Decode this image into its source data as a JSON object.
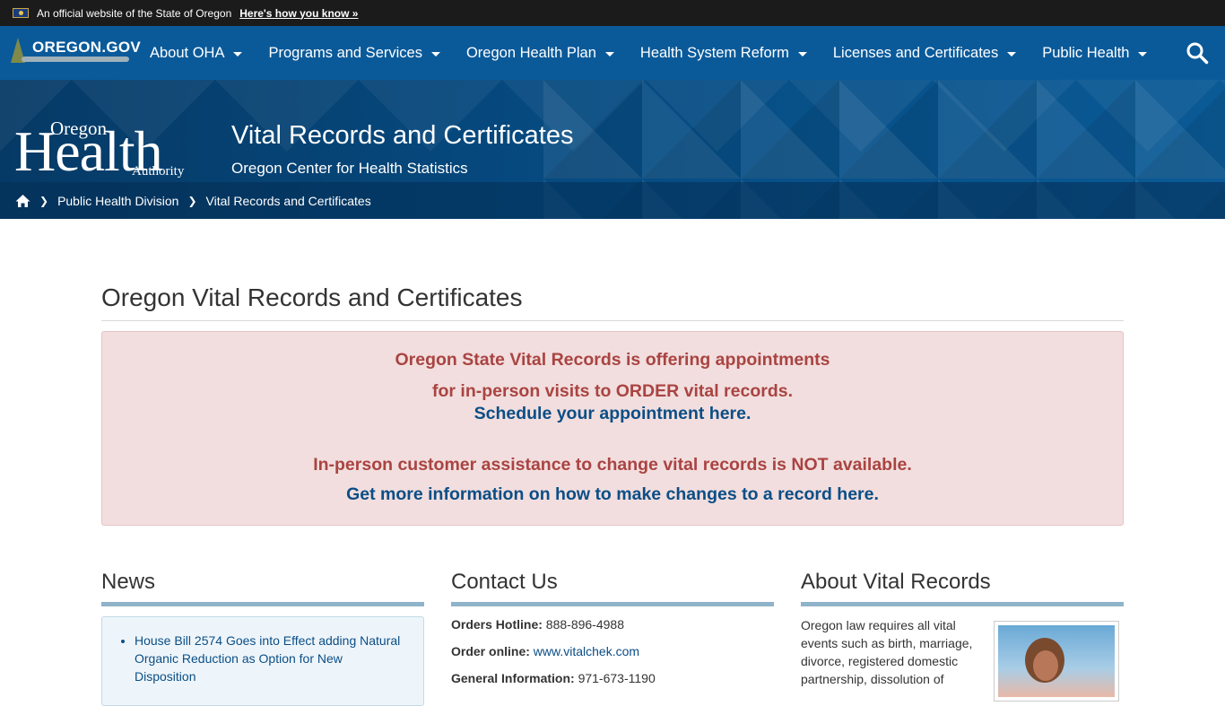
{
  "gov_banner": {
    "official_text": "An official website of the State of Oregon",
    "how_link": "Here's how you know »"
  },
  "topnav": {
    "brand": "OREGON.GOV",
    "items": [
      {
        "label": "About OHA"
      },
      {
        "label": "Programs and Services"
      },
      {
        "label": "Oregon Health Plan"
      },
      {
        "label": "Health System Reform"
      },
      {
        "label": "Licenses and Certificates"
      },
      {
        "label": "Public Health"
      }
    ],
    "search_icon": "search-icon"
  },
  "hero": {
    "logo": {
      "top": "Oregon",
      "main": "Health",
      "bottom": "Authority"
    },
    "title": "Vital Records and Certificates",
    "subtitle": "Oregon Center for Health Statistics"
  },
  "breadcrumb": {
    "items": [
      "Public Health Division",
      "Vital Records and Certificates"
    ]
  },
  "main": {
    "page_title": "Oregon Vital Records and Certificates",
    "alert": {
      "line1": "Oregon State Vital Records is offering appointments",
      "line2": "for in-person visits to ORDER vital records.",
      "line3_link": "Schedule your appointment here",
      "line3_tail": ".",
      "line4": "In-person customer assistance to change vital records is NOT available.",
      "line5_link": "Get more information on how to make changes to a record here."
    }
  },
  "news": {
    "title": "News",
    "items": [
      "House Bill 2574 Goes into Effect adding Natural Organic Reduction as Option for New Disposition"
    ]
  },
  "contact": {
    "title": "Contact Us",
    "orders_label": "Orders Hotline:",
    "orders_value": "888-896-4988",
    "online_label": "Order online:",
    "online_value": "www.vitalchek.com",
    "info_label": "General Information:",
    "info_value": "971-673-1190"
  },
  "about": {
    "title": "About Vital Records",
    "text": "Oregon law requires all vital events such as birth, marriage, divorce, registered domestic partnership, dissolution of"
  },
  "colors": {
    "nav_bg": "#0a5a9a",
    "alert_bg": "#f2dede",
    "alert_text": "#a94442",
    "link": "#0b4e86"
  }
}
